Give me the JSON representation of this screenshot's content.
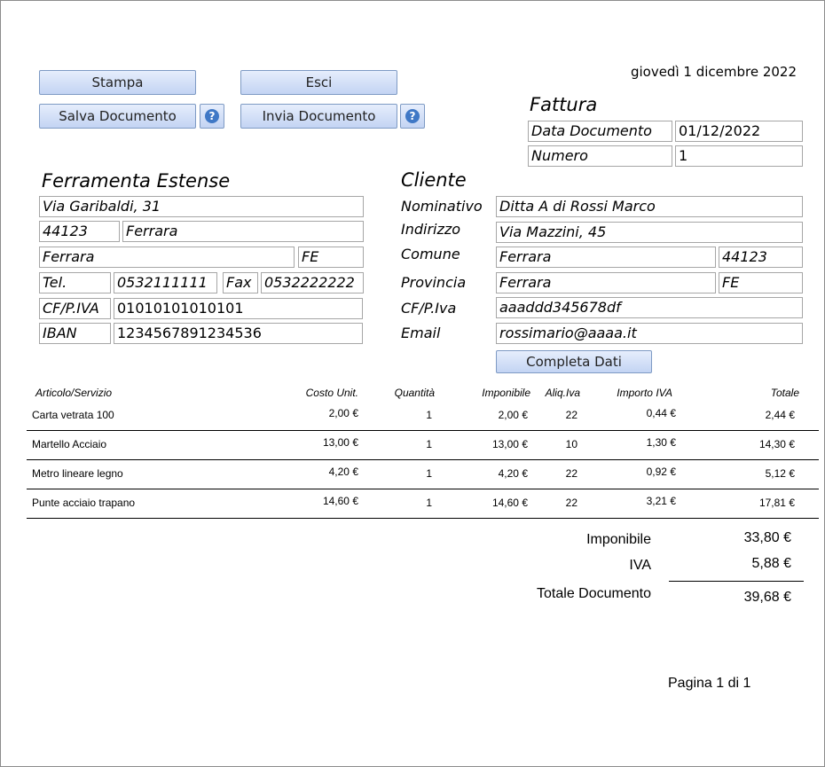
{
  "date_line": "giovedì 1 dicembre 2022",
  "buttons": {
    "print": "Stampa",
    "exit": "Esci",
    "save": "Salva Documento",
    "send": "Invia Documento",
    "complete": "Completa Dati",
    "help": "?"
  },
  "invoice": {
    "title": "Fattura",
    "date_label": "Data Documento",
    "date_value": "01/12/2022",
    "number_label": "Numero",
    "number_value": "1"
  },
  "company": {
    "name": "Ferramenta Estense",
    "address": "Via Garibaldi, 31",
    "cap": "44123",
    "city": "Ferrara",
    "comune": "Ferrara",
    "province": "FE",
    "tel_label": "Tel.",
    "tel": "0532111111",
    "fax_label": "Fax",
    "fax": "0532222222",
    "cf_label": "CF/P.IVA",
    "cf": "01010101010101",
    "iban_label": "IBAN",
    "iban": "1234567891234536"
  },
  "client": {
    "title": "Cliente",
    "name_label": "Nominativo",
    "name": "Ditta A di Rossi Marco",
    "address_label": "Indirizzo",
    "address": "Via Mazzini, 45",
    "comune_label": "Comune",
    "comune": "Ferrara",
    "cap": "44123",
    "province_label": "Provincia",
    "province": "Ferrara",
    "province_code": "FE",
    "cf_label": "CF/P.Iva",
    "cf": "aaaddd345678df",
    "email_label": "Email",
    "email": "rossimario@aaaa.it"
  },
  "table": {
    "headers": {
      "item": "Articolo/Servizio",
      "unit_cost": "Costo Unit.",
      "qty": "Quantità",
      "taxable": "Imponibile",
      "vat_rate": "Aliq.Iva",
      "vat_amount": "Importo IVA",
      "total": "Totale"
    },
    "rows": [
      {
        "item": "Carta vetrata 100",
        "unit_cost": "2,00 €",
        "qty": "1",
        "taxable": "2,00 €",
        "vat_rate": "22",
        "vat_amount": "0,44 €",
        "total": "2,44 €"
      },
      {
        "item": "Martello Acciaio",
        "unit_cost": "13,00 €",
        "qty": "1",
        "taxable": "13,00 €",
        "vat_rate": "10",
        "vat_amount": "1,30 €",
        "total": "14,30 €"
      },
      {
        "item": "Metro lineare legno",
        "unit_cost": "4,20 €",
        "qty": "1",
        "taxable": "4,20 €",
        "vat_rate": "22",
        "vat_amount": "0,92 €",
        "total": "5,12 €"
      },
      {
        "item": "Punte acciaio trapano",
        "unit_cost": "14,60 €",
        "qty": "1",
        "taxable": "14,60 €",
        "vat_rate": "22",
        "vat_amount": "3,21 €",
        "total": "17,81 €"
      }
    ]
  },
  "totals": {
    "taxable_label": "Imponibile",
    "taxable": "33,80 €",
    "vat_label": "IVA",
    "vat": "5,88 €",
    "total_label": "Totale Documento",
    "total": "39,68 €"
  },
  "page_footer": "Pagina 1 di 1"
}
